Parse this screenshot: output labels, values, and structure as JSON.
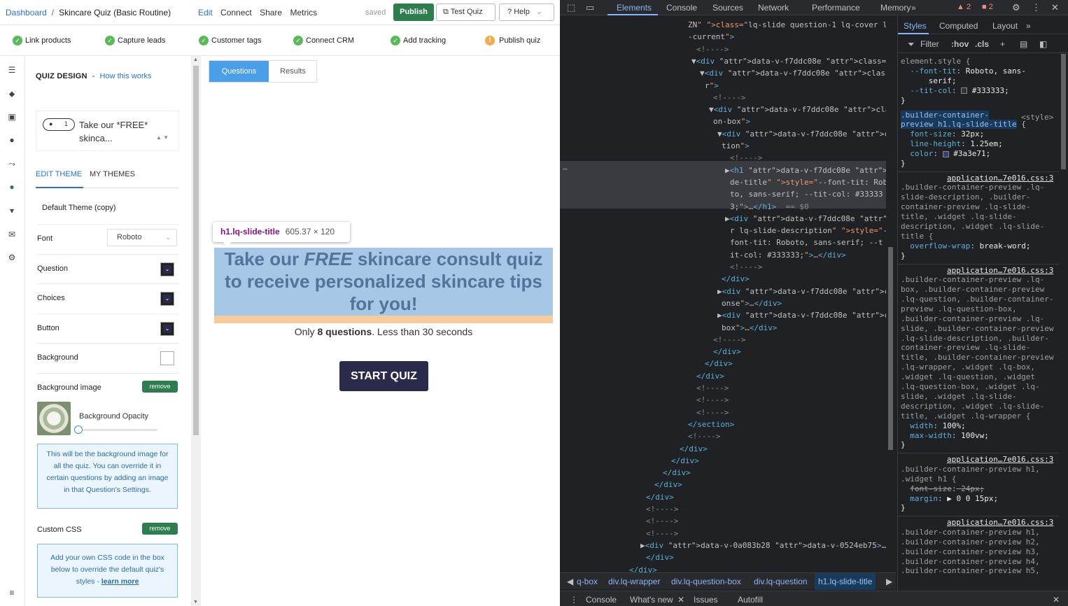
{
  "app": {
    "breadcrumb": {
      "home": "Dashboard",
      "sep": "/",
      "current": "Skincare Quiz (Basic Routine)"
    },
    "topnav": [
      "Edit",
      "Connect",
      "Share",
      "Metrics"
    ],
    "status": "saved",
    "publish_label": "Publish",
    "test_label": "Test Quiz",
    "help_label": "Help",
    "steps": [
      {
        "label": "Link products",
        "state": "done"
      },
      {
        "label": "Capture leads",
        "state": "done"
      },
      {
        "label": "Customer tags",
        "state": "done"
      },
      {
        "label": "Connect CRM",
        "state": "done"
      },
      {
        "label": "Add tracking",
        "state": "done"
      },
      {
        "label": "Publish quiz",
        "state": "warning"
      }
    ],
    "panel": {
      "heading": "QUIZ DESIGN",
      "dash": "-",
      "how_link": "How this works",
      "question_num": "1",
      "question_text_1": "Take our *FREE*",
      "question_text_2": "skinca...",
      "tab_edit": "EDIT THEME",
      "tab_mine": "MY THEMES",
      "theme_name": "Default Theme (copy)",
      "font_label": "Font",
      "font_value": "Roboto",
      "question_label": "Question",
      "choices_label": "Choices",
      "button_label": "Button",
      "background_label": "Background",
      "bg_image_label": "Background image",
      "remove_label": "remove",
      "opacity_label": "Background Opacity",
      "bg_info": "This will be the background image for all the quiz. You can override it in certain questions by adding an image in that Question's Settings.",
      "css_label": "Custom CSS",
      "css_info": "Add your own CSS code in the box below to override the default quiz's styles - ",
      "learn_more": "learn more"
    },
    "preview": {
      "tab_questions": "Questions",
      "tab_results": "Results",
      "tooltip_selector": "h1.lq-slide-title",
      "tooltip_dims": "605.37 × 120",
      "title_pre": "Take our ",
      "title_em": "FREE",
      "title_post": " skincare consult quiz to receive personalized skincare tips for you!",
      "desc_pre": "Only ",
      "desc_bold": "8 questions",
      "desc_post": ". Less than 30 seconds",
      "start_label": "START QUIZ"
    }
  },
  "devtools": {
    "tabs": [
      "Elements",
      "Console",
      "Sources",
      "Network",
      "Performance",
      "Memory"
    ],
    "more_tabs": "»",
    "warn_count": "2",
    "error_count": "2",
    "dom_lines": [
      "ZN\" class=\"lq-slide question-1 lq-cover lq",
      "-current\">",
      "<!---->",
      "▼<div data-v-f7ddc08e class=\"lq-box\">",
      "▼<div data-v-f7ddc08e class=\"lq-wrappe",
      "r\">",
      "<!---->",
      "▼<div data-v-f7ddc08e class=\"lq-questi",
      "on-box\">",
      "▼<div data-v-f7ddc08e class=\"lq-ques",
      "tion\">",
      "<!---->",
      "▶<h1 data-v-f7ddc08e class=\"lq-sli",
      "de-title\" style=\"--font-tit: Robo",
      "to, sans-serif; --tit-col: #33333",
      "3;\">…</h1> == $0",
      "▶<div data-v-f7ddc08e class=\"cente",
      "r lq-slide-description\" style=\"--",
      "font-tit: Roboto, sans-serif; --t",
      "it-col: #333333;\">…</div>",
      "<!---->",
      "</div>",
      "▶<div data-v-f7ddc08e class=\"lq-resp",
      "onse\">…</div>",
      "▶<div data-v-f7ddc08e class=\"lq-cta-",
      "box\">…</div>",
      "<!---->",
      "</div>",
      "</div>",
      "</div>",
      "<!---->",
      "<!---->",
      "<!---->",
      "</section>",
      "<!---->",
      "</div>",
      "</div>",
      "</div>",
      "</div>",
      "</div>",
      "<!---->",
      "<!---->",
      "<!---->",
      "▶<div data-v-0a083b28 data-v-0524eb75>…</div>",
      "</div>",
      "</div>"
    ],
    "crumbs": [
      "q-box",
      "div.lq-wrapper",
      "div.lq-question-box",
      "div.lq-question",
      "h1.lq-slide-title"
    ],
    "drawer": [
      "Console",
      "What's new",
      "Issues",
      "Autofill"
    ],
    "styles_tabs": [
      "Styles",
      "Computed",
      "Layout"
    ],
    "filter_label": "Filter",
    "hov": ":hov",
    "cls": ".cls",
    "style_lines": [
      "element.style {",
      "  --font-tit: Roboto, sans-",
      "      serif;",
      "  --tit-col: ■ #333333;",
      "}",
      ".builder-container-",
      "preview h1.lq-slide-title {",
      "  font-size: 32px;",
      "  line-height: 1.25em;",
      "  color: ■ #3a3e71;",
      "}",
      "application…7e016.css:3",
      ".builder-container-preview .lq-",
      "slide-description, .builder-",
      "container-preview .lq-slide-",
      "title, .widget .lq-slide-",
      "description, .widget .lq-slide-",
      "title {",
      "  overflow-wrap: break-word;",
      "}",
      "application…7e016.css:3",
      ".builder-container-preview .lq-",
      "box, .builder-container-preview",
      ".lq-question, .builder-container-",
      "preview .lq-question-box,",
      ".builder-container-preview .lq-",
      "slide, .builder-container-preview",
      ".lq-slide-description, .builder-",
      "container-preview .lq-slide-",
      "title, .builder-container-preview",
      ".lq-wrapper, .widget .lq-box,",
      ".widget .lq-question, .widget",
      ".lq-question-box, .widget .lq-",
      "slide, .widget .lq-slide-",
      "description, .widget .lq-slide-",
      "title, .widget .lq-wrapper {",
      "  width: 100%;",
      "  max-width: 100vw;",
      "}",
      "application…7e016.css:3",
      ".builder-container-preview h1,",
      ".widget h1 {",
      "  font-size: 24px;",
      "  margin: ▶ 0 0 15px;",
      "}",
      "application…7e016.css:3",
      ".builder-container-preview h1,",
      ".builder-container-preview h2,",
      ".builder-container-preview h3,",
      ".builder-container-preview h4,",
      ".builder-container-preview h5,"
    ],
    "style_source_tag": "<style>"
  },
  "colors": {
    "publish": "#2e7d4f",
    "accent": "#2a73c5",
    "cta": "#2a2a4a",
    "title": "#53739a"
  }
}
